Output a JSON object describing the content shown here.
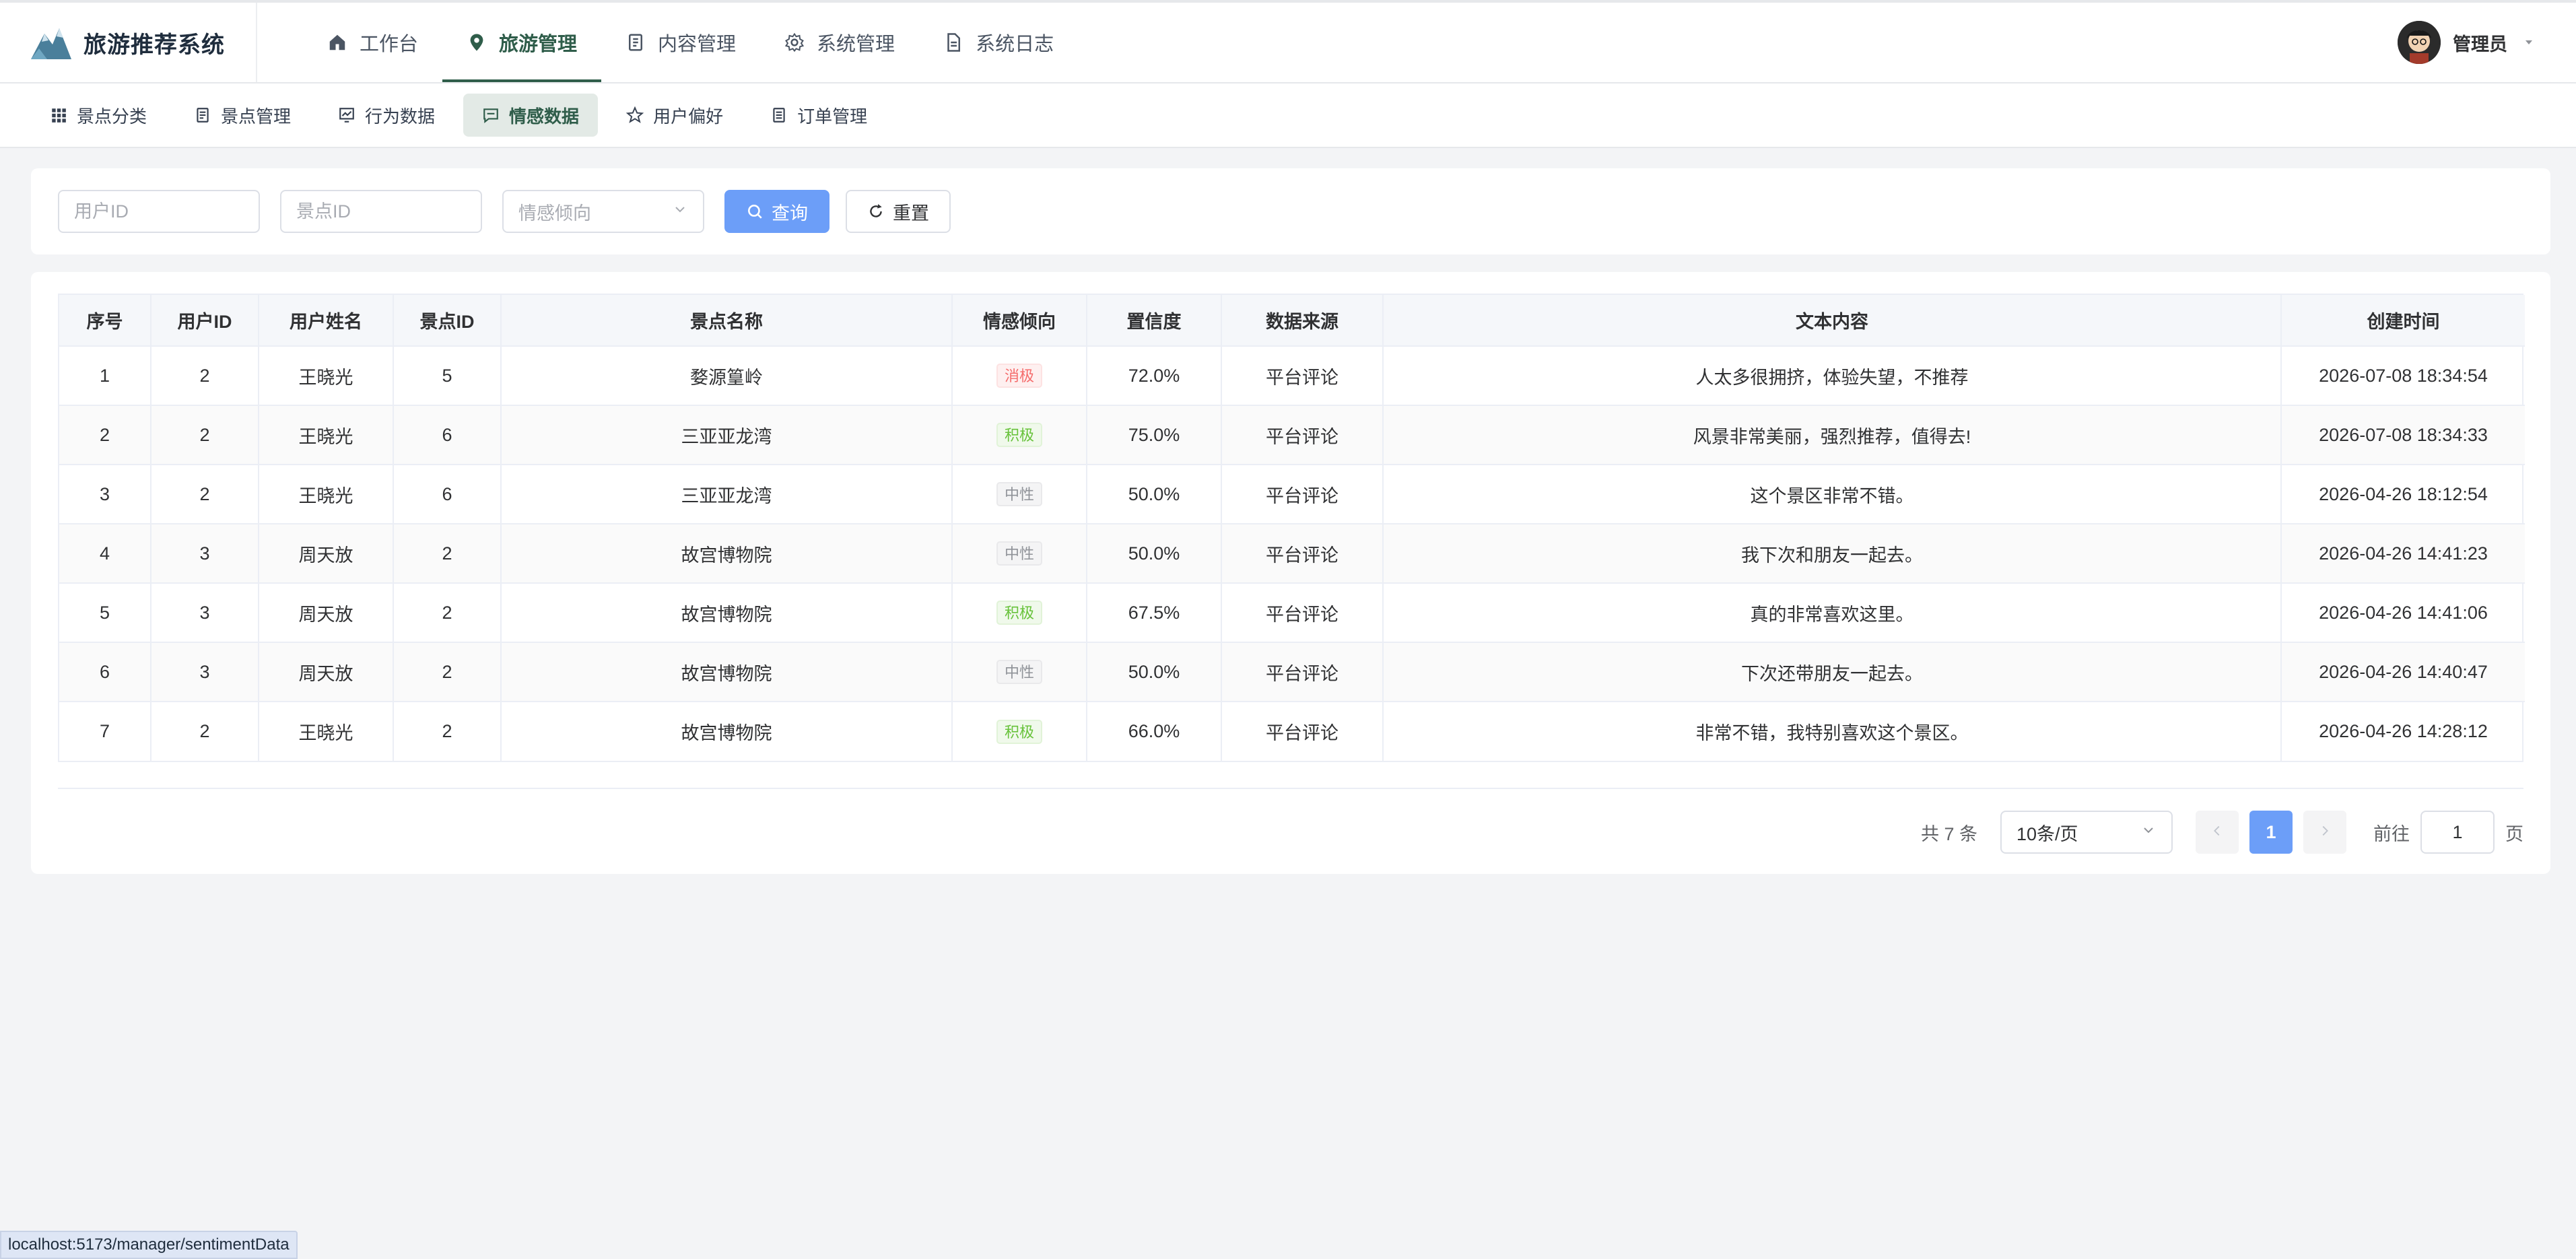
{
  "header": {
    "brand": "旅游推荐系统",
    "nav": [
      {
        "label": "工作台",
        "icon": "home-icon",
        "active": false
      },
      {
        "label": "旅游管理",
        "icon": "location-icon",
        "active": true
      },
      {
        "label": "内容管理",
        "icon": "book-icon",
        "active": false
      },
      {
        "label": "系统管理",
        "icon": "gear-icon",
        "active": false
      },
      {
        "label": "系统日志",
        "icon": "document-icon",
        "active": false
      }
    ],
    "user": {
      "name": "管理员"
    }
  },
  "subnav": [
    {
      "label": "景点分类",
      "icon": "grid-icon",
      "active": false
    },
    {
      "label": "景点管理",
      "icon": "document-icon",
      "active": false
    },
    {
      "label": "行为数据",
      "icon": "chart-icon",
      "active": false
    },
    {
      "label": "情感数据",
      "icon": "chat-icon",
      "active": true
    },
    {
      "label": "用户偏好",
      "icon": "star-icon",
      "active": false
    },
    {
      "label": "订单管理",
      "icon": "list-icon",
      "active": false
    }
  ],
  "filters": {
    "user_id_placeholder": "用户ID",
    "spot_id_placeholder": "景点ID",
    "sentiment_placeholder": "情感倾向",
    "search_label": "查询",
    "reset_label": "重置"
  },
  "table": {
    "columns": [
      "序号",
      "用户ID",
      "用户姓名",
      "景点ID",
      "景点名称",
      "情感倾向",
      "置信度",
      "数据来源",
      "文本内容",
      "创建时间"
    ],
    "rows": [
      {
        "index": "1",
        "user_id": "2",
        "user_name": "王晓光",
        "spot_id": "5",
        "spot_name": "婺源篁岭",
        "sentiment": "消极",
        "sentiment_type": "neg",
        "confidence": "72.0%",
        "source": "平台评论",
        "text": "人太多很拥挤，体验失望，不推荐",
        "created": "2026-07-08 18:34:54"
      },
      {
        "index": "2",
        "user_id": "2",
        "user_name": "王晓光",
        "spot_id": "6",
        "spot_name": "三亚亚龙湾",
        "sentiment": "积极",
        "sentiment_type": "pos",
        "confidence": "75.0%",
        "source": "平台评论",
        "text": "风景非常美丽，强烈推荐，值得去!",
        "created": "2026-07-08 18:34:33"
      },
      {
        "index": "3",
        "user_id": "2",
        "user_name": "王晓光",
        "spot_id": "6",
        "spot_name": "三亚亚龙湾",
        "sentiment": "中性",
        "sentiment_type": "neu",
        "confidence": "50.0%",
        "source": "平台评论",
        "text": "这个景区非常不错。",
        "created": "2026-04-26 18:12:54"
      },
      {
        "index": "4",
        "user_id": "3",
        "user_name": "周天放",
        "spot_id": "2",
        "spot_name": "故宫博物院",
        "sentiment": "中性",
        "sentiment_type": "neu",
        "confidence": "50.0%",
        "source": "平台评论",
        "text": "我下次和朋友一起去。",
        "created": "2026-04-26 14:41:23"
      },
      {
        "index": "5",
        "user_id": "3",
        "user_name": "周天放",
        "spot_id": "2",
        "spot_name": "故宫博物院",
        "sentiment": "积极",
        "sentiment_type": "pos",
        "confidence": "67.5%",
        "source": "平台评论",
        "text": "真的非常喜欢这里。",
        "created": "2026-04-26 14:41:06"
      },
      {
        "index": "6",
        "user_id": "3",
        "user_name": "周天放",
        "spot_id": "2",
        "spot_name": "故宫博物院",
        "sentiment": "中性",
        "sentiment_type": "neu",
        "confidence": "50.0%",
        "source": "平台评论",
        "text": "下次还带朋友一起去。",
        "created": "2026-04-26 14:40:47"
      },
      {
        "index": "7",
        "user_id": "2",
        "user_name": "王晓光",
        "spot_id": "2",
        "spot_name": "故宫博物院",
        "sentiment": "积极",
        "sentiment_type": "pos",
        "confidence": "66.0%",
        "source": "平台评论",
        "text": "非常不错，我特别喜欢这个景区。",
        "created": "2026-04-26 14:28:12"
      }
    ]
  },
  "pagination": {
    "total": "共 7 条",
    "page_size": "10条/页",
    "current_page": "1",
    "goto_label": "前往",
    "goto_value": "1",
    "page_unit": "页"
  },
  "statusbar": {
    "url": "localhost:5173/manager/sentimentData"
  },
  "colors": {
    "accent": "#2f5d4a",
    "primary": "#6c9ef8"
  }
}
